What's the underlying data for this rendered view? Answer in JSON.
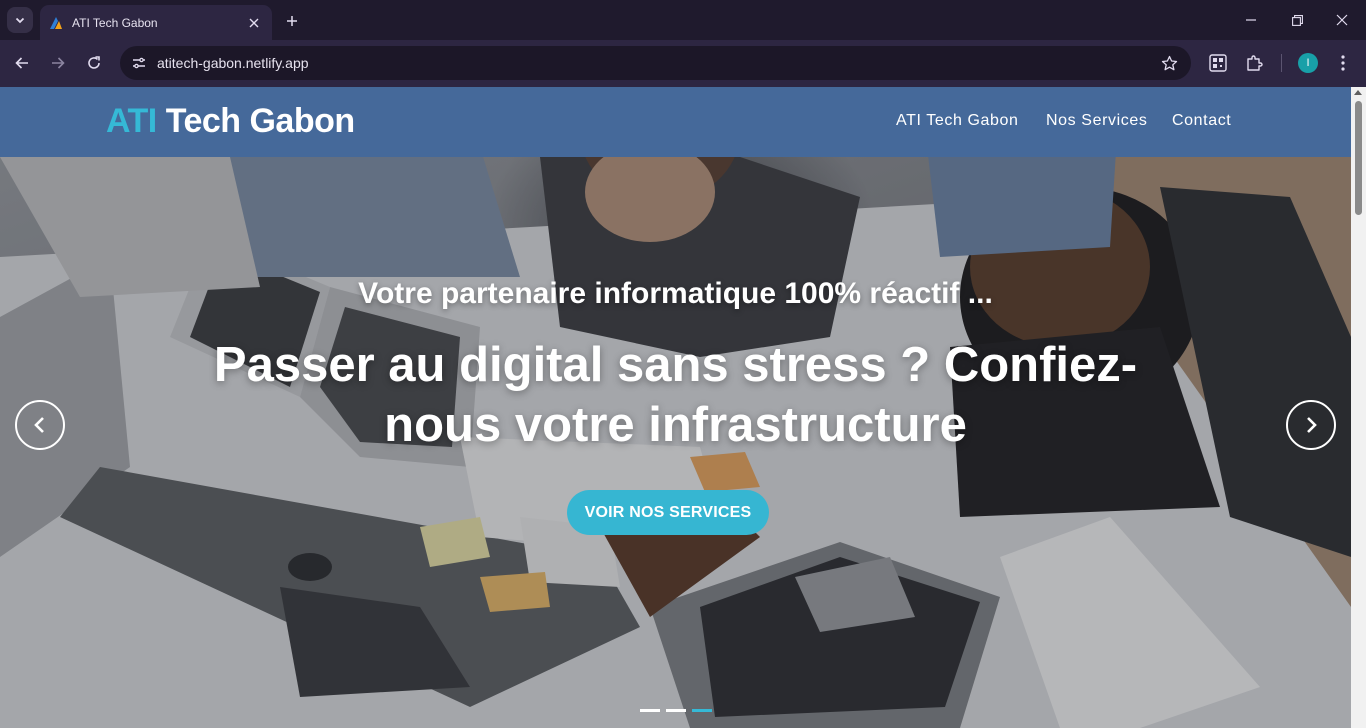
{
  "browser": {
    "tab": {
      "title": "ATI Tech Gabon"
    },
    "address": {
      "url": "atitech-gabon.netlify.app"
    },
    "profile": {
      "initial": "I"
    }
  },
  "site": {
    "brand": {
      "accent": "ATI",
      "rest": " Tech Gabon"
    },
    "nav": [
      {
        "label": "ATI Tech Gabon"
      },
      {
        "label": "Nos Services"
      },
      {
        "label": "Contact"
      }
    ],
    "hero": {
      "subtitle": "Votre partenaire informatique 100% réactif ...",
      "title": "Passer au digital sans stress ? Confiez-nous votre infrastructure",
      "cta": "VOIR NOS SERVICES"
    },
    "carousel": {
      "slide_count": 3,
      "active_slide": 3
    }
  },
  "colors": {
    "header_bg": "#45699a",
    "accent": "#35b9d6",
    "chrome_bg": "#1f1a2d",
    "toolbar_bg": "#2d2642"
  },
  "icons": {
    "tab_search": "chevron-down-icon",
    "new_tab": "plus-icon",
    "back": "arrow-left-icon",
    "forward": "arrow-right-icon",
    "reload": "reload-icon",
    "site_info": "tune-icon",
    "bookmark": "star-icon",
    "qr": "qr-code-icon",
    "extensions": "puzzle-icon",
    "menu": "kebab-menu-icon",
    "prev_slide": "chevron-left-icon",
    "next_slide": "chevron-right-icon"
  }
}
